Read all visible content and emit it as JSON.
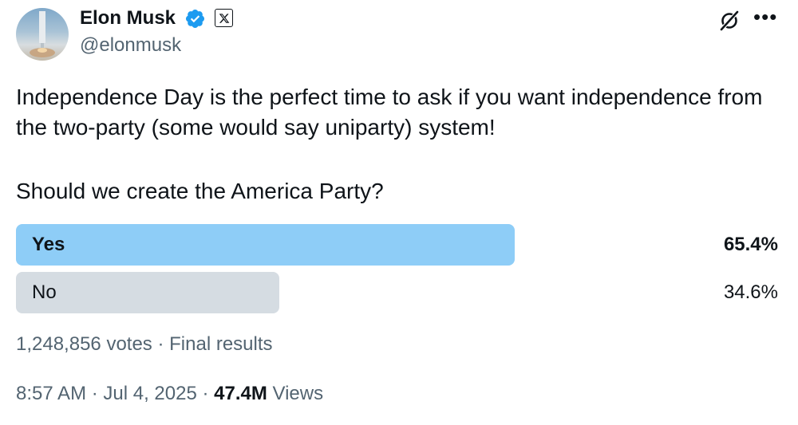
{
  "author": {
    "name": "Elon Musk",
    "handle": "@elonmusk",
    "verified_color": "#1d9bf0"
  },
  "icons": {
    "verified": "verified-badge-icon",
    "affiliate": "x-logo-icon",
    "grok": "grok-icon",
    "more": "more-options-icon"
  },
  "tweet": {
    "line1": "Independence Day is the perfect time to ask if you want independence from the two-party (some would say uniparty) system!",
    "line2": "Should we create the America Party?"
  },
  "poll": {
    "options": [
      {
        "label": "Yes",
        "percent_text": "65.4%",
        "percent": 65.4,
        "winner": true,
        "bar_color": "#8ecdf7"
      },
      {
        "label": "No",
        "percent_text": "34.6%",
        "percent": 34.6,
        "winner": false,
        "bar_color": "#d5dce2"
      }
    ],
    "votes": "1,248,856 votes",
    "separator": " · ",
    "status": "Final results"
  },
  "meta": {
    "time": "8:57 AM",
    "dot": " · ",
    "date": "Jul 4, 2025",
    "views_count": "47.4M",
    "views_label": " Views"
  }
}
